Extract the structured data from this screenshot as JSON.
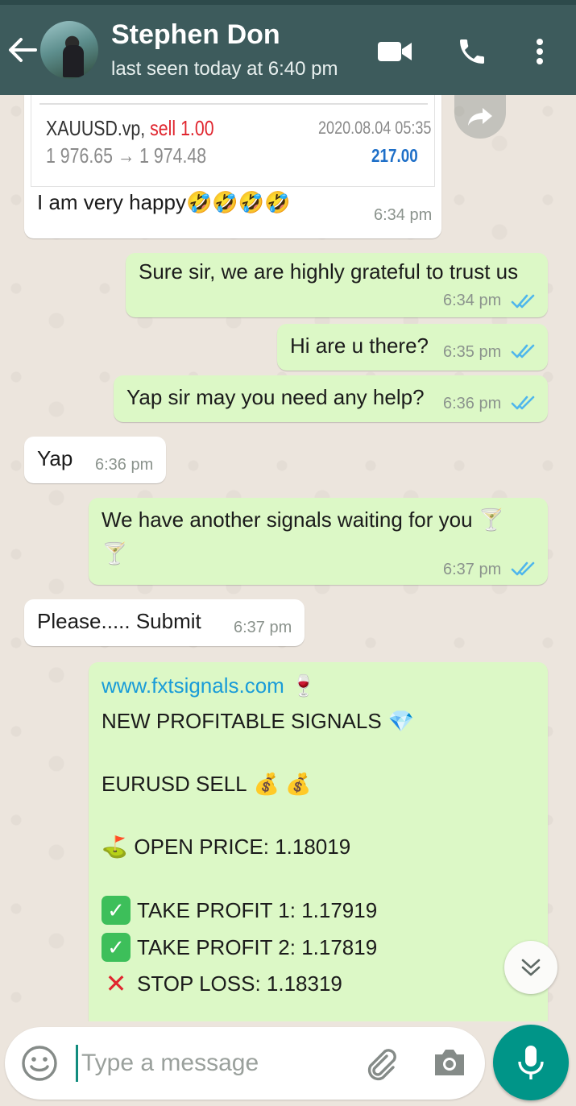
{
  "header": {
    "contact_name": "Stephen Don",
    "status": "last seen today at 6:40 pm"
  },
  "icons": {
    "back": "arrow-back-icon",
    "video": "video-call-icon",
    "call": "phone-icon",
    "menu": "more-vert-icon",
    "forward": "forward-icon",
    "scroll_down": "double-chevron-down-icon",
    "emoji": "emoji-icon",
    "attach": "paperclip-icon",
    "camera": "camera-icon",
    "mic": "mic-icon"
  },
  "trade": {
    "symbol": "XAUUSD.vp,",
    "side": "sell 1.00",
    "prices": "1 976.65 → 1 974.48",
    "datetime": "2020.08.04 05:35",
    "profit": "217.00"
  },
  "messages": [
    {
      "direction": "in",
      "text": "I am very happy🤣🤣🤣🤣",
      "time": "6:34 pm"
    },
    {
      "direction": "out",
      "text": "Sure sir, we are highly grateful to trust us",
      "time": "6:34 pm"
    },
    {
      "direction": "out",
      "text": "Hi are u there?",
      "time": "6:35 pm"
    },
    {
      "direction": "out",
      "text": "Yap sir may you need any help?",
      "time": "6:36 pm"
    },
    {
      "direction": "in",
      "text": "Yap",
      "time": "6:36 pm"
    },
    {
      "direction": "out",
      "text": "We have another signals waiting for you 🍸",
      "text2": "🍸",
      "time": "6:37 pm"
    },
    {
      "direction": "in",
      "text": "Please..... Submit",
      "time": "6:37 pm"
    }
  ],
  "signal": {
    "link": "www.fxtsignals.com",
    "link_emoji": "🍷",
    "headline": "NEW PROFITABLE SIGNALS",
    "headline_emoji": "💎",
    "pair": "EURUSD SELL",
    "pair_emoji": "💰 💰",
    "open_emoji": "⛳",
    "open": "OPEN PRICE: 1.18019",
    "check": "✓",
    "tp1": "TAKE PROFIT 1: 1.17919",
    "tp2": "TAKE PROFIT 2: 1.17819",
    "cross": "✕",
    "sl": "STOP LOSS: 1.18319"
  },
  "composer": {
    "placeholder": "Type a message"
  },
  "colors": {
    "appbar": "#3d5b5c",
    "incoming": "#ffffff",
    "outgoing": "#dcf8c6",
    "read_ticks": "#4fb6ec",
    "mic_button": "#009588",
    "link": "#1a9cd8"
  }
}
